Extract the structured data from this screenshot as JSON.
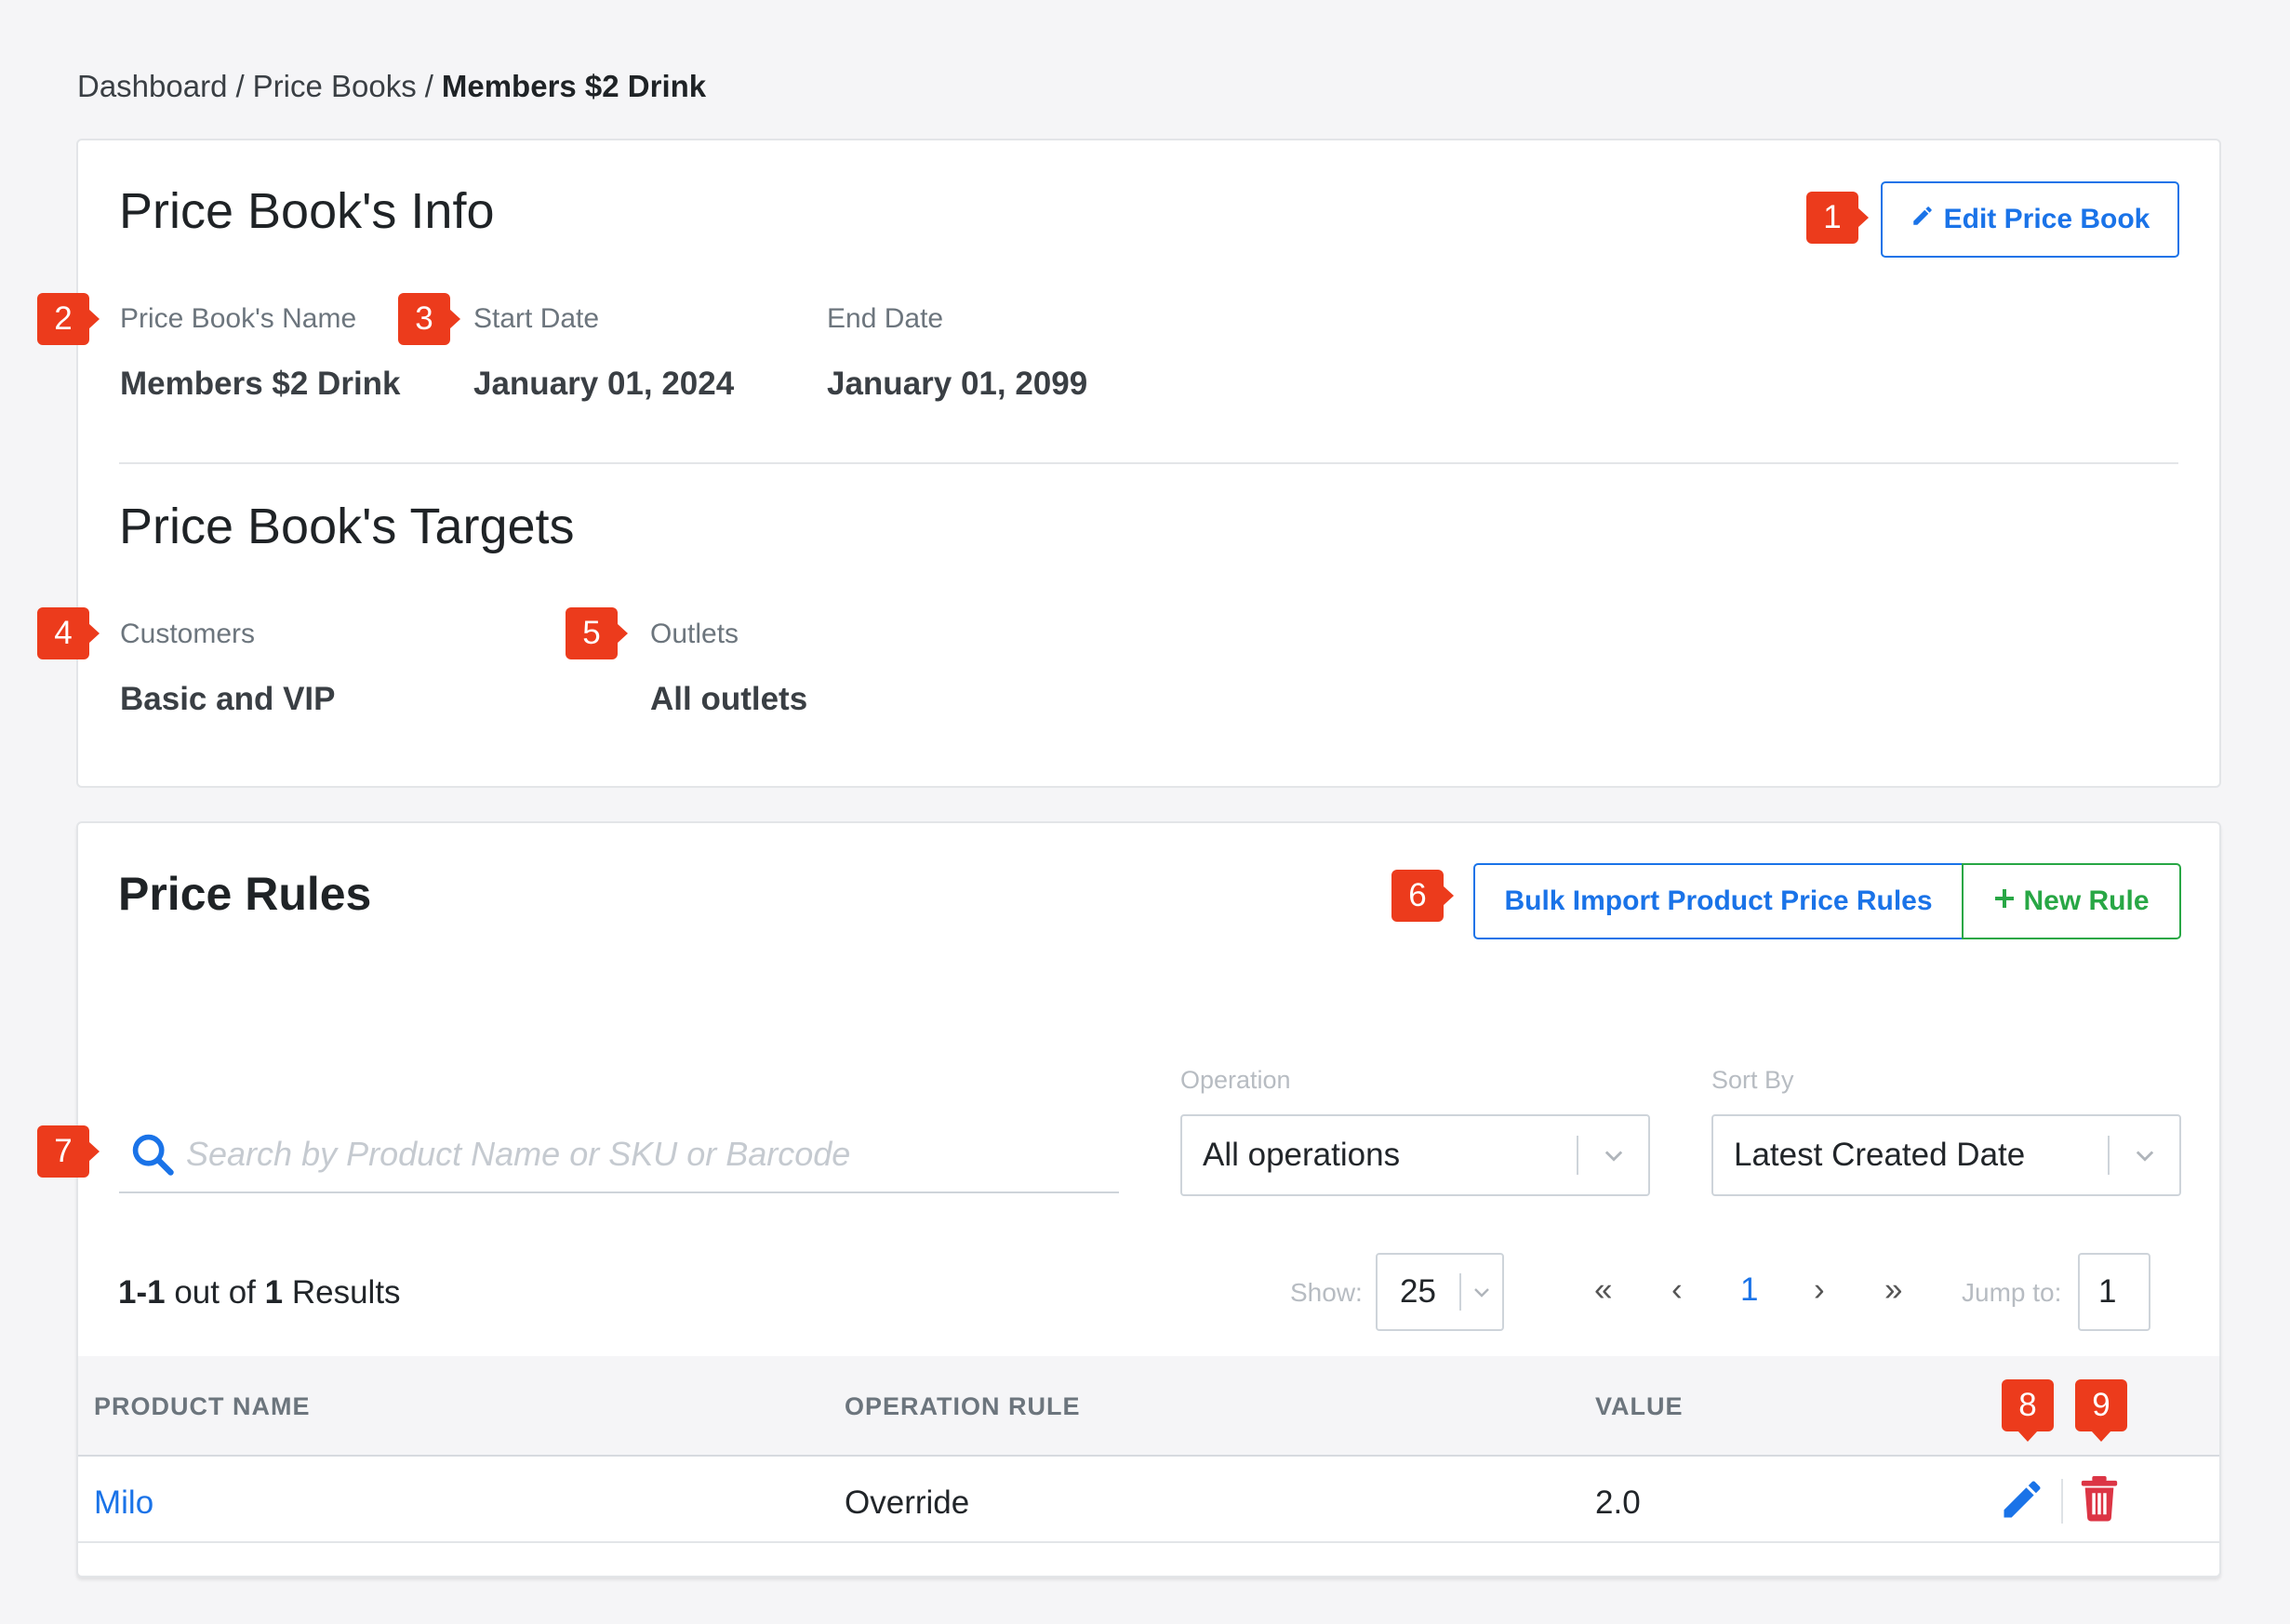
{
  "breadcrumb": {
    "items": [
      "Dashboard",
      "Price Books"
    ],
    "separator": "/",
    "current": "Members $2 Drink"
  },
  "info": {
    "title": "Price Book's Info",
    "edit_button": "Edit Price Book",
    "name_label": "Price Book's Name",
    "name_value": "Members $2 Drink",
    "start_label": "Start Date",
    "start_value": "January 01, 2024",
    "end_label": "End Date",
    "end_value": "January 01, 2099"
  },
  "targets": {
    "title": "Price Book's Targets",
    "customers_label": "Customers",
    "customers_value": "Basic and VIP",
    "outlets_label": "Outlets",
    "outlets_value": "All outlets"
  },
  "rules": {
    "title": "Price Rules",
    "bulk_import_button": "Bulk Import Product Price Rules",
    "new_rule_button": "New Rule",
    "search_placeholder": "Search by Product Name or SKU or Barcode",
    "operation_label": "Operation",
    "operation_value": "All operations",
    "sortby_label": "Sort By",
    "sortby_value": "Latest Created Date",
    "results": {
      "range": "1-1",
      "out_of": "out of",
      "total": "1",
      "suffix": "Results"
    },
    "show_label": "Show:",
    "show_value": "25",
    "pagination": {
      "first": "«",
      "prev": "‹",
      "current": "1",
      "next": "›",
      "last": "»"
    },
    "jump_label": "Jump to:",
    "jump_value": "1",
    "columns": [
      "PRODUCT NAME",
      "OPERATION RULE",
      "VALUE"
    ],
    "rows": [
      {
        "product": "Milo",
        "operation": "Override",
        "value": "2.0"
      }
    ]
  },
  "annotations": [
    "1",
    "2",
    "3",
    "4",
    "5",
    "6",
    "7",
    "8",
    "9"
  ],
  "colors": {
    "primary": "#1a73e8",
    "success": "#28a745",
    "danger": "#dc3545",
    "badge": "#ec3b1c"
  },
  "icons": {
    "edit": "pencil-icon",
    "add": "plus-icon",
    "search": "search-icon",
    "delete": "trash-icon",
    "dropdown": "chevron-down-icon"
  }
}
